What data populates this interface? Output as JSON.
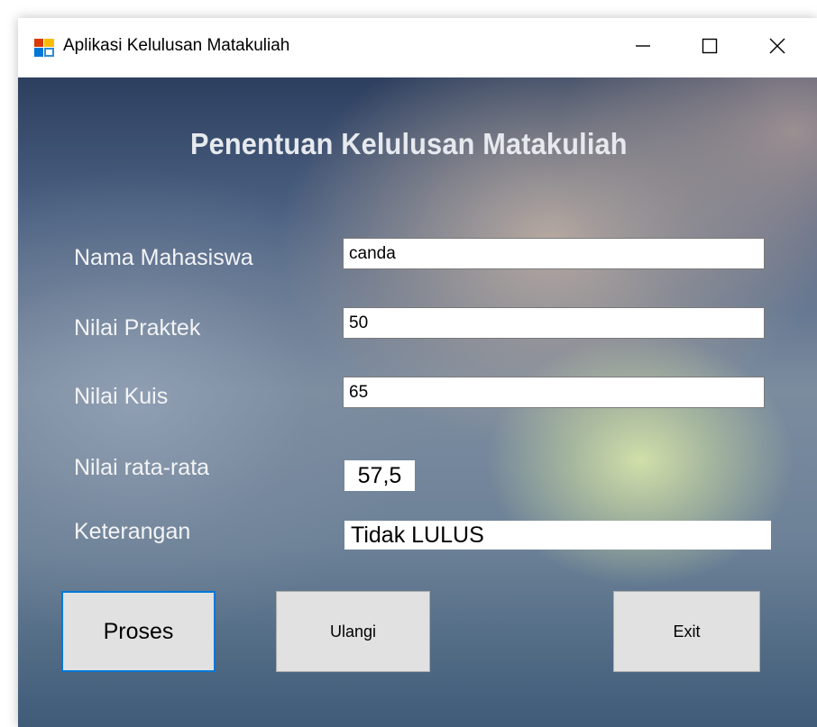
{
  "window": {
    "title": "Aplikasi Kelulusan Matakuliah",
    "controls": {
      "minimize_icon": "minimize-icon",
      "maximize_icon": "maximize-icon",
      "close_icon": "close-icon"
    }
  },
  "form": {
    "heading": "Penentuan Kelulusan Matakuliah",
    "fields": {
      "nama_mahasiswa": {
        "label": "Nama Mahasiswa",
        "value": "canda"
      },
      "nilai_praktek": {
        "label": "Nilai Praktek",
        "value": "50"
      },
      "nilai_kuis": {
        "label": "Nilai Kuis",
        "value": "65"
      },
      "nilai_rata_rata": {
        "label": "Nilai rata-rata",
        "value": "57,5"
      },
      "keterangan": {
        "label": "Keterangan",
        "value": "Tidak LULUS"
      }
    },
    "buttons": {
      "proses": "Proses",
      "ulangi": "Ulangi",
      "exit": "Exit"
    }
  },
  "colors": {
    "focus_border": "#0078d7",
    "button_face": "#e1e1e1",
    "label_text": "#f3f4f6"
  }
}
